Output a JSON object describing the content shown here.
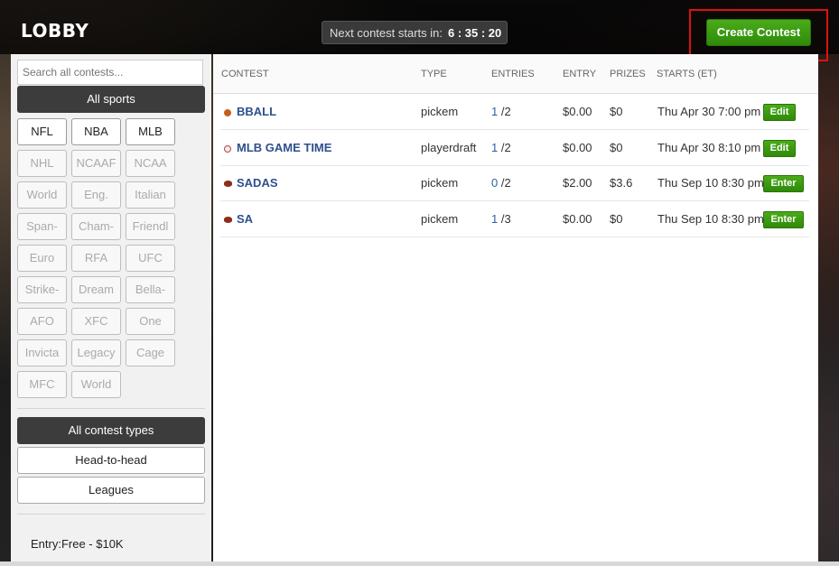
{
  "header": {
    "title": "LOBBY",
    "timer_label": "Next contest starts in:",
    "timer_value": "6 : 35 : 20",
    "create_label": "Create Contest"
  },
  "sidebar": {
    "search_placeholder": "Search all contests...",
    "all_sports": "All sports",
    "sports": [
      {
        "label": "NFL",
        "active": true
      },
      {
        "label": "NBA",
        "active": true
      },
      {
        "label": "MLB",
        "active": true
      },
      {
        "label": "NHL",
        "active": false
      },
      {
        "label": "NCAAF",
        "active": false
      },
      {
        "label": "NCAA",
        "active": false
      },
      {
        "label": "World",
        "active": false
      },
      {
        "label": "Eng.",
        "active": false
      },
      {
        "label": "Italian",
        "active": false
      },
      {
        "label": "Span-",
        "active": false
      },
      {
        "label": "Cham-",
        "active": false
      },
      {
        "label": "Friendl",
        "active": false
      },
      {
        "label": "Euro",
        "active": false
      },
      {
        "label": "RFA",
        "active": false
      },
      {
        "label": "UFC",
        "active": false
      },
      {
        "label": "Strike-",
        "active": false
      },
      {
        "label": "Dream",
        "active": false
      },
      {
        "label": "Bella-",
        "active": false
      },
      {
        "label": "AFO",
        "active": false
      },
      {
        "label": "XFC",
        "active": false
      },
      {
        "label": "One",
        "active": false
      },
      {
        "label": "Invicta",
        "active": false
      },
      {
        "label": "Legacy",
        "active": false
      },
      {
        "label": "Cage",
        "active": false
      },
      {
        "label": "MFC",
        "active": false
      },
      {
        "label": "World",
        "active": false
      }
    ],
    "all_types": "All contest types",
    "head_to_head": "Head-to-head",
    "leagues": "Leagues",
    "entry_label": "Entry:Free  -  $10K"
  },
  "table": {
    "headers": {
      "contest": "CONTEST",
      "type": "TYPE",
      "entries": "ENTRIES",
      "entry": "ENTRY",
      "prizes": "PRIZES",
      "starts": "STARTS (ET)"
    },
    "rows": [
      {
        "icon": "basketball-icon",
        "name": "BBALL",
        "type": "pickem",
        "entries": "1",
        "max": "/2",
        "entry": "$0.00",
        "prizes": "$0",
        "starts": "Thu Apr 30 7:00 pm",
        "action": "Edit"
      },
      {
        "icon": "baseball-icon",
        "name": "MLB GAME TIME",
        "type": "playerdraft",
        "entries": "1",
        "max": "/2",
        "entry": "$0.00",
        "prizes": "$0",
        "starts": "Thu Apr 30 8:10 pm",
        "action": "Edit"
      },
      {
        "icon": "football-icon",
        "name": "SADAS",
        "type": "pickem",
        "entries": "0",
        "max": "/2",
        "entry": "$2.00",
        "prizes": "$3.6",
        "starts": "Thu Sep 10 8:30 pm",
        "action": "Enter"
      },
      {
        "icon": "football-icon",
        "name": "SA",
        "type": "pickem",
        "entries": "1",
        "max": "/3",
        "entry": "$0.00",
        "prizes": "$0",
        "starts": "Thu Sep 10 8:30 pm",
        "action": "Enter"
      }
    ]
  }
}
